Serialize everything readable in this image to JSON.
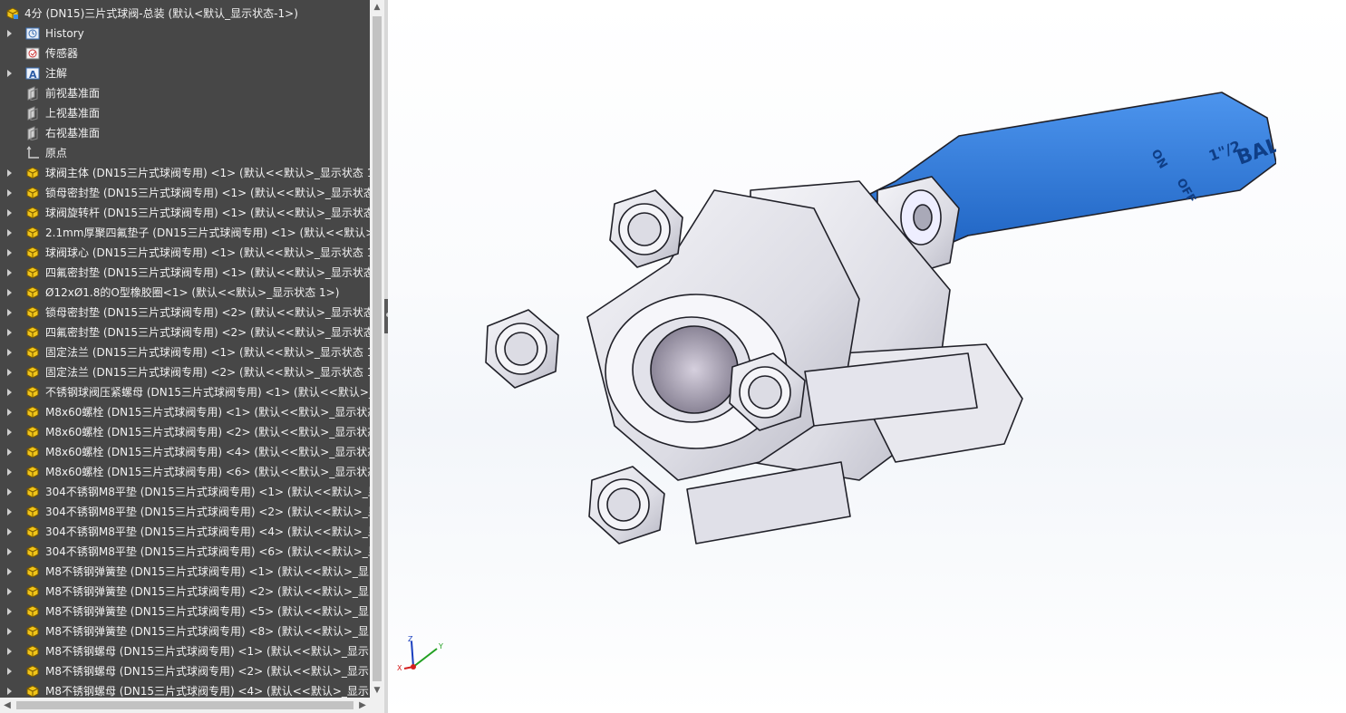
{
  "tree": {
    "root": "4分 (DN15)三片式球阀-总装 (默认<默认_显示状态-1>)",
    "items": [
      {
        "label": "History",
        "icon": "history-icon",
        "expand": true
      },
      {
        "label": "传感器",
        "icon": "sensor-icon",
        "expand": false
      },
      {
        "label": "注解",
        "icon": "annotation-icon",
        "expand": true
      },
      {
        "label": "前视基准面",
        "icon": "plane-icon",
        "expand": false
      },
      {
        "label": "上视基准面",
        "icon": "plane-icon",
        "expand": false
      },
      {
        "label": "右视基准面",
        "icon": "plane-icon",
        "expand": false
      },
      {
        "label": "原点",
        "icon": "origin-icon",
        "expand": false
      },
      {
        "label": "球阀主体 (DN15三片式球阀专用) <1> (默认<<默认>_显示状态 1",
        "icon": "part-icon",
        "expand": true
      },
      {
        "label": "锁母密封垫 (DN15三片式球阀专用) <1> (默认<<默认>_显示状态",
        "icon": "part-icon",
        "expand": true
      },
      {
        "label": "球阀旋转杆 (DN15三片式球阀专用) <1> (默认<<默认>_显示状态",
        "icon": "part-icon",
        "expand": true
      },
      {
        "label": "2.1mm厚聚四氟垫子 (DN15三片式球阀专用) <1> (默认<<默认>",
        "icon": "part-icon",
        "expand": true
      },
      {
        "label": "球阀球心 (DN15三片式球阀专用) <1> (默认<<默认>_显示状态 1",
        "icon": "part-icon",
        "expand": true
      },
      {
        "label": "四氟密封垫 (DN15三片式球阀专用) <1> (默认<<默认>_显示状态",
        "icon": "part-icon",
        "expand": true
      },
      {
        "label": "Ø12xØ1.8的O型橡胶圈<1> (默认<<默认>_显示状态 1>)",
        "icon": "part-icon",
        "expand": true
      },
      {
        "label": "锁母密封垫 (DN15三片式球阀专用) <2> (默认<<默认>_显示状态",
        "icon": "part-icon",
        "expand": true
      },
      {
        "label": "四氟密封垫 (DN15三片式球阀专用) <2> (默认<<默认>_显示状态",
        "icon": "part-icon",
        "expand": true
      },
      {
        "label": "固定法兰 (DN15三片式球阀专用) <1> (默认<<默认>_显示状态 1",
        "icon": "part-icon",
        "expand": true
      },
      {
        "label": "固定法兰 (DN15三片式球阀专用) <2> (默认<<默认>_显示状态 1",
        "icon": "part-icon",
        "expand": true
      },
      {
        "label": "不锈钢球阀压紧螺母 (DN15三片式球阀专用) <1> (默认<<默认>_",
        "icon": "part-icon",
        "expand": true
      },
      {
        "label": "M8x60螺栓 (DN15三片式球阀专用) <1> (默认<<默认>_显示状态",
        "icon": "part-icon",
        "expand": true
      },
      {
        "label": "M8x60螺栓 (DN15三片式球阀专用) <2> (默认<<默认>_显示状态",
        "icon": "part-icon",
        "expand": true
      },
      {
        "label": "M8x60螺栓 (DN15三片式球阀专用) <4> (默认<<默认>_显示状态",
        "icon": "part-icon",
        "expand": true
      },
      {
        "label": "M8x60螺栓 (DN15三片式球阀专用) <6> (默认<<默认>_显示状态",
        "icon": "part-icon",
        "expand": true
      },
      {
        "label": "304不锈钢M8平垫 (DN15三片式球阀专用) <1> (默认<<默认>_显",
        "icon": "part-icon",
        "expand": true
      },
      {
        "label": "304不锈钢M8平垫 (DN15三片式球阀专用) <2> (默认<<默认>_显",
        "icon": "part-icon",
        "expand": true
      },
      {
        "label": "304不锈钢M8平垫 (DN15三片式球阀专用) <4> (默认<<默认>_显",
        "icon": "part-icon",
        "expand": true
      },
      {
        "label": "304不锈钢M8平垫 (DN15三片式球阀专用) <6> (默认<<默认>_显",
        "icon": "part-icon",
        "expand": true
      },
      {
        "label": "M8不锈钢弹簧垫 (DN15三片式球阀专用) <1> (默认<<默认>_显",
        "icon": "part-icon",
        "expand": true
      },
      {
        "label": "M8不锈钢弹簧垫 (DN15三片式球阀专用) <2> (默认<<默认>_显",
        "icon": "part-icon",
        "expand": true
      },
      {
        "label": "M8不锈钢弹簧垫 (DN15三片式球阀专用) <5> (默认<<默认>_显",
        "icon": "part-icon",
        "expand": true
      },
      {
        "label": "M8不锈钢弹簧垫 (DN15三片式球阀专用) <8> (默认<<默认>_显",
        "icon": "part-icon",
        "expand": true
      },
      {
        "label": "M8不锈钢螺母 (DN15三片式球阀专用) <1> (默认<<默认>_显示",
        "icon": "part-icon",
        "expand": true
      },
      {
        "label": "M8不锈钢螺母 (DN15三片式球阀专用) <2> (默认<<默认>_显示",
        "icon": "part-icon",
        "expand": true
      },
      {
        "label": "M8不锈钢螺母 (DN15三片式球阀专用) <4> (默认<<默认>_显示",
        "icon": "part-icon",
        "expand": true
      }
    ]
  },
  "handle_text": {
    "on": "ON",
    "off": "OFF",
    "size": "1\"/2",
    "brand": "BALL VALVE"
  },
  "triad": {
    "x": "X",
    "y": "Y",
    "z": "Z"
  },
  "colors": {
    "panel_bg": "#474747",
    "part_icon": "#f0c419",
    "handle_blue": "#1e6fd9",
    "metal": "#dcdce4"
  }
}
